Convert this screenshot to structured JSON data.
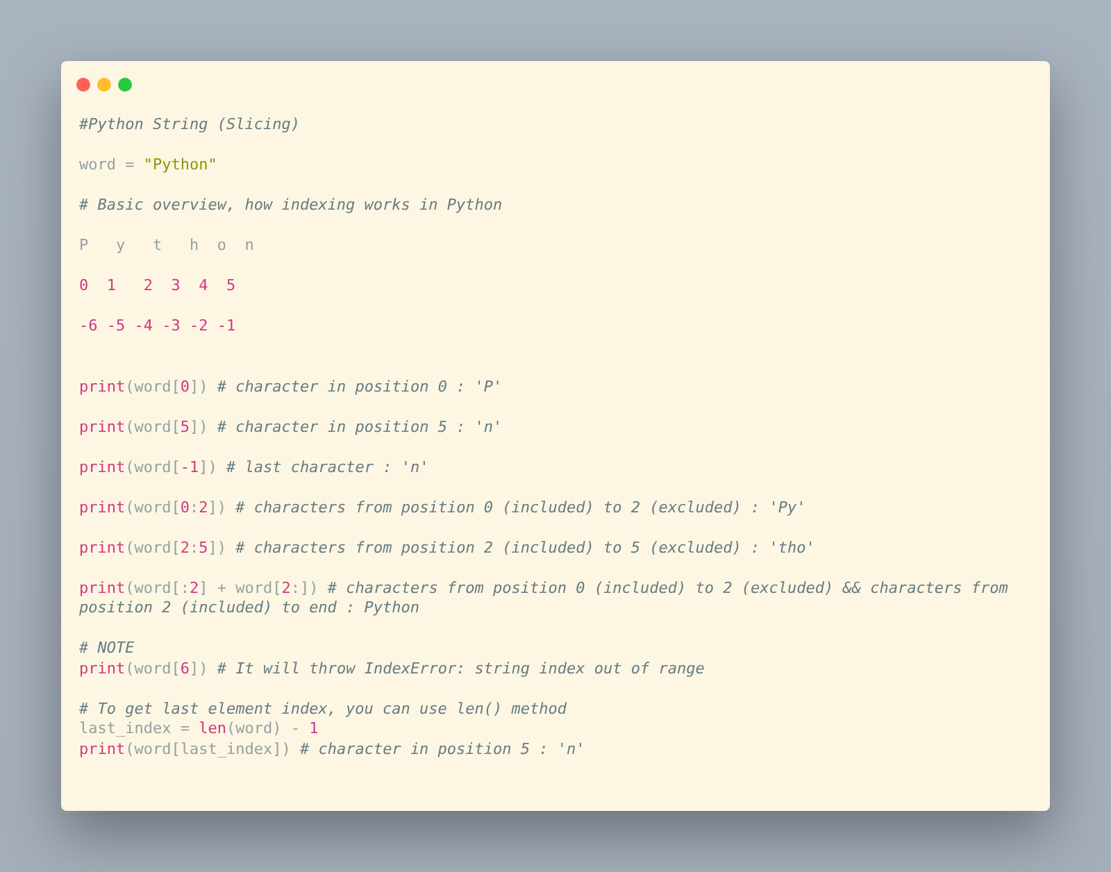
{
  "window": {
    "controls": [
      {
        "color": "#ff5f56"
      },
      {
        "color": "#ffbd2e"
      },
      {
        "color": "#27c93f"
      }
    ]
  },
  "code": {
    "blocks": [
      {
        "lines": [
          [
            {
              "kind": "comment",
              "text": "#Python String (Slicing)"
            }
          ]
        ]
      },
      {
        "lines": [
          [
            {
              "kind": "plain",
              "text": "word = "
            },
            {
              "kind": "string",
              "text": "\"Python\""
            }
          ]
        ]
      },
      {
        "lines": [
          [
            {
              "kind": "comment",
              "text": "# Basic overview, how indexing works in Python"
            }
          ]
        ]
      },
      {
        "lines": [
          [
            {
              "kind": "plain",
              "text": "P   y   t   h  o  n"
            }
          ]
        ]
      },
      {
        "lines": [
          [
            {
              "kind": "number",
              "text": "0  1   2  3  4  5"
            }
          ]
        ]
      },
      {
        "lines": [
          [
            {
              "kind": "number",
              "text": "-6 -5 -4 -3 -2 -1"
            }
          ]
        ]
      },
      {
        "wide_gap": true,
        "lines": [
          [
            {
              "kind": "keyword",
              "text": "print"
            },
            {
              "kind": "plain",
              "text": "(word["
            },
            {
              "kind": "number",
              "text": "0"
            },
            {
              "kind": "plain",
              "text": "]) "
            },
            {
              "kind": "comment",
              "text": "# character in position 0 : 'P'"
            }
          ]
        ]
      },
      {
        "lines": [
          [
            {
              "kind": "keyword",
              "text": "print"
            },
            {
              "kind": "plain",
              "text": "(word["
            },
            {
              "kind": "number",
              "text": "5"
            },
            {
              "kind": "plain",
              "text": "]) "
            },
            {
              "kind": "comment",
              "text": "# character in position 5 : 'n'"
            }
          ]
        ]
      },
      {
        "lines": [
          [
            {
              "kind": "keyword",
              "text": "print"
            },
            {
              "kind": "plain",
              "text": "(word["
            },
            {
              "kind": "number",
              "text": "-1"
            },
            {
              "kind": "plain",
              "text": "]) "
            },
            {
              "kind": "comment",
              "text": "# last character : 'n'"
            }
          ]
        ]
      },
      {
        "lines": [
          [
            {
              "kind": "keyword",
              "text": "print"
            },
            {
              "kind": "plain",
              "text": "(word["
            },
            {
              "kind": "number",
              "text": "0"
            },
            {
              "kind": "plain",
              "text": ":"
            },
            {
              "kind": "number",
              "text": "2"
            },
            {
              "kind": "plain",
              "text": "]) "
            },
            {
              "kind": "comment",
              "text": "# characters from position 0 (included) to 2 (excluded) : 'Py'"
            }
          ]
        ]
      },
      {
        "lines": [
          [
            {
              "kind": "keyword",
              "text": "print"
            },
            {
              "kind": "plain",
              "text": "(word["
            },
            {
              "kind": "number",
              "text": "2"
            },
            {
              "kind": "plain",
              "text": ":"
            },
            {
              "kind": "number",
              "text": "5"
            },
            {
              "kind": "plain",
              "text": "]) "
            },
            {
              "kind": "comment",
              "text": "# characters from position 2 (included) to 5 (excluded) : 'tho'"
            }
          ]
        ]
      },
      {
        "lines": [
          [
            {
              "kind": "keyword",
              "text": "print"
            },
            {
              "kind": "plain",
              "text": "(word[:"
            },
            {
              "kind": "number",
              "text": "2"
            },
            {
              "kind": "plain",
              "text": "] + word["
            },
            {
              "kind": "number",
              "text": "2"
            },
            {
              "kind": "plain",
              "text": ":]) "
            },
            {
              "kind": "comment",
              "text": "# characters from position 0 (included) to 2 (excluded) && characters from position 2 (included) to end : Python"
            }
          ]
        ]
      },
      {
        "lines": [
          [
            {
              "kind": "comment",
              "text": "# NOTE"
            }
          ],
          [
            {
              "kind": "keyword",
              "text": "print"
            },
            {
              "kind": "plain",
              "text": "(word["
            },
            {
              "kind": "number",
              "text": "6"
            },
            {
              "kind": "plain",
              "text": "]) "
            },
            {
              "kind": "comment",
              "text": "# It will throw IndexError: string index out of range"
            }
          ]
        ]
      },
      {
        "lines": [
          [
            {
              "kind": "comment",
              "text": "# To get last element index, you can use len() method"
            }
          ],
          [
            {
              "kind": "plain",
              "text": "last_index = "
            },
            {
              "kind": "keyword",
              "text": "len"
            },
            {
              "kind": "plain",
              "text": "(word) - "
            },
            {
              "kind": "number",
              "text": "1"
            }
          ],
          [
            {
              "kind": "keyword",
              "text": "print"
            },
            {
              "kind": "plain",
              "text": "(word[last_index]) "
            },
            {
              "kind": "comment",
              "text": "# character in position 5 : 'n'"
            }
          ]
        ]
      }
    ]
  }
}
